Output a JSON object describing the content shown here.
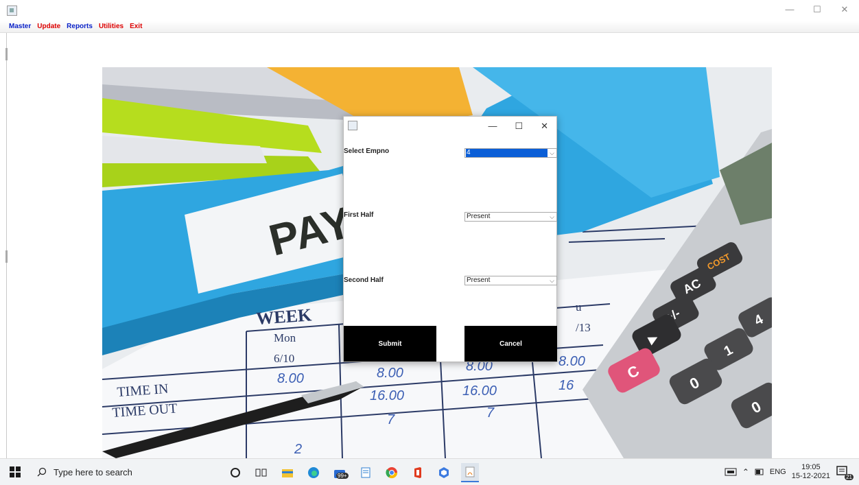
{
  "main_window": {
    "menu": [
      {
        "label": "Master",
        "color": "blue"
      },
      {
        "label": "Update",
        "color": "red"
      },
      {
        "label": "Reports",
        "color": "blue"
      },
      {
        "label": "Utilities",
        "color": "red"
      },
      {
        "label": "Exit",
        "color": "red"
      }
    ],
    "controls": {
      "minimize": "—",
      "maximize": "☐",
      "close": "✕"
    }
  },
  "background_photo": {
    "folder_label": "PAY",
    "sheet_title": "WEEK",
    "day": "Mon",
    "date": "6/10",
    "date2": "/13",
    "row_labels": [
      "TIME IN",
      "TIME OUT"
    ],
    "values": [
      "8.00",
      "8.00",
      "8.00",
      "8.00",
      "16.00",
      "16.00",
      "16",
      "7",
      "7",
      "2",
      "u"
    ],
    "calculator_keys": [
      "COST",
      "AC",
      "+/-",
      "4",
      "1",
      "C",
      "0",
      "0",
      "▶"
    ]
  },
  "dialog": {
    "controls": {
      "minimize": "—",
      "maximize": "☐",
      "close": "✕"
    },
    "empno_label": "Select Empno",
    "empno_value": "4",
    "first_half_label": "First Half",
    "first_half_value": "Present",
    "second_half_label": "Second Half",
    "second_half_value": "Present",
    "submit_label": "Submit",
    "cancel_label": "Cancel"
  },
  "taskbar": {
    "search_placeholder": "Type here to search",
    "badge": "99+",
    "lang": "ENG",
    "time": "19:05",
    "date": "15-12-2021",
    "notifications": "21"
  }
}
